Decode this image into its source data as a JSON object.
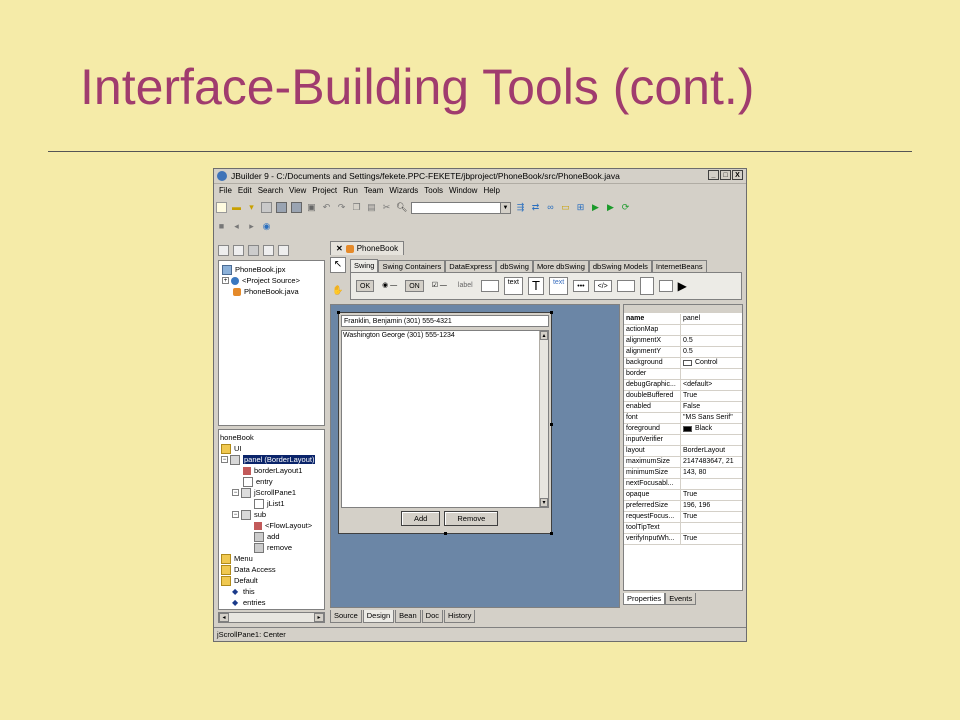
{
  "slide": {
    "title": "Interface-Building Tools (cont.)"
  },
  "window": {
    "title": "JBuilder 9 - C:/Documents and Settings/fekete.PPC-FEKETE/jbproject/PhoneBook/src/PhoneBook.java",
    "controls": [
      "_",
      "□",
      "X"
    ]
  },
  "menu": [
    "File",
    "Edit",
    "Search",
    "View",
    "Project",
    "Run",
    "Team",
    "Wizards",
    "Tools",
    "Window",
    "Help"
  ],
  "project_tree": [
    {
      "label": "PhoneBook.jpx",
      "icon": "project-icon"
    },
    {
      "label": "<Project Source>",
      "icon": "package-icon"
    },
    {
      "label": "PhoneBook.java",
      "icon": "java-file-icon"
    }
  ],
  "structure_tree": {
    "root": "honeBook",
    "items": [
      {
        "label": "UI",
        "icon": "folder-icon"
      },
      {
        "label": "panel (BorderLayout)",
        "icon": "panel-icon",
        "selected": true
      },
      {
        "label": "borderLayout1",
        "icon": "layout-icon"
      },
      {
        "label": "entry",
        "icon": "textfield-icon"
      },
      {
        "label": "jScrollPane1",
        "icon": "scrollpane-icon"
      },
      {
        "label": "jList1",
        "icon": "list-icon"
      },
      {
        "label": "sub",
        "icon": "panel-icon"
      },
      {
        "label": "<FlowLayout>",
        "icon": "layout-icon"
      },
      {
        "label": "add",
        "icon": "button-icon"
      },
      {
        "label": "remove",
        "icon": "button-icon"
      },
      {
        "label": "Menu",
        "icon": "folder-icon"
      },
      {
        "label": "Data Access",
        "icon": "folder-icon"
      },
      {
        "label": "Default",
        "icon": "folder-icon"
      },
      {
        "label": "this",
        "icon": "field-icon"
      },
      {
        "label": "entries",
        "icon": "field-icon"
      }
    ]
  },
  "file_tab": "PhoneBook",
  "palette_tabs": [
    "Swing",
    "Swing Containers",
    "DataExpress",
    "dbSwing",
    "More dbSwing",
    "dbSwing Models",
    "InternetBeans"
  ],
  "palette_items": [
    "OK",
    "ON",
    "label",
    "text",
    "T",
    "text",
    "•••",
    "</>"
  ],
  "design": {
    "entry_text": "Franklin, Benjamin (301) 555-4321",
    "list_items": [
      "Washington George (301) 555-1234"
    ],
    "add_button": "Add",
    "remove_button": "Remove"
  },
  "inspector": {
    "rows": [
      {
        "name": "name",
        "value": "panel"
      },
      {
        "name": "actionMap",
        "value": ""
      },
      {
        "name": "alignmentX",
        "value": "0.5"
      },
      {
        "name": "alignmentY",
        "value": "0.5"
      },
      {
        "name": "background",
        "value": "Control",
        "swatch": "#ffffff"
      },
      {
        "name": "border",
        "value": ""
      },
      {
        "name": "debugGraphic...",
        "value": "<default>"
      },
      {
        "name": "doubleBuffered",
        "value": "True"
      },
      {
        "name": "enabled",
        "value": "False"
      },
      {
        "name": "font",
        "value": "\"MS Sans Serif\""
      },
      {
        "name": "foreground",
        "value": "Black",
        "swatch": "#000000"
      },
      {
        "name": "inputVerifier",
        "value": ""
      },
      {
        "name": "layout",
        "value": "BorderLayout"
      },
      {
        "name": "maximumSize",
        "value": "2147483647, 21"
      },
      {
        "name": "minimumSize",
        "value": "143, 80"
      },
      {
        "name": "nextFocusabl...",
        "value": ""
      },
      {
        "name": "opaque",
        "value": "True"
      },
      {
        "name": "preferredSize",
        "value": "196, 196"
      },
      {
        "name": "requestFocus...",
        "value": "True"
      },
      {
        "name": "toolTipText",
        "value": ""
      },
      {
        "name": "verifyInputWh...",
        "value": "True"
      }
    ],
    "tabs": [
      "Properties",
      "Events"
    ]
  },
  "bottom_tabs": [
    "Source",
    "Design",
    "Bean",
    "Doc",
    "History"
  ],
  "status": "jScrollPane1: Center"
}
